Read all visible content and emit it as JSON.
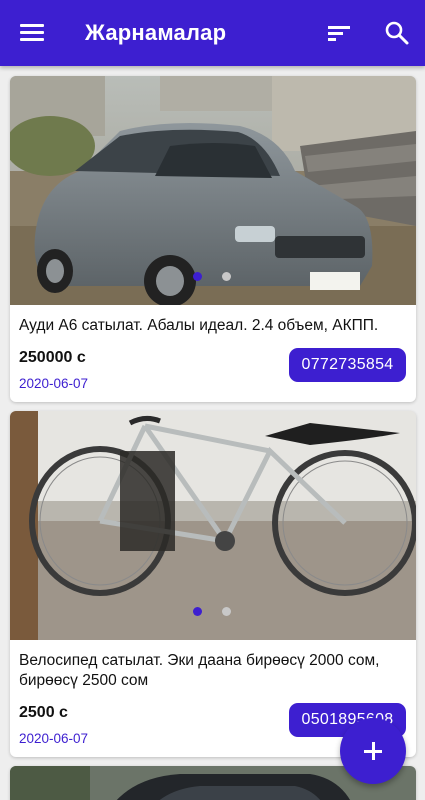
{
  "appbar": {
    "title": "Жарнамалар",
    "icons": [
      "menu-icon",
      "sort-icon",
      "search-icon"
    ]
  },
  "colors": {
    "primary": "#3d1fd0",
    "background": "#eeeeee",
    "card": "#ffffff"
  },
  "listings": [
    {
      "description": "Ауди А6 сатылат. Абалы идеал. 2.4 объем, АКПП.",
      "price": "250000 с",
      "date": "2020-06-07",
      "phone": "0772735854",
      "photo_count": 2,
      "active_photo": 0
    },
    {
      "description": "Велосипед сатылат. Эки даана бирөөсү 2000 сом, бирөөсү 2500 сом",
      "price": "2500 с",
      "date": "2020-06-07",
      "phone": "0501895608",
      "photo_count": 2,
      "active_photo": 0
    }
  ],
  "fab": {
    "icon": "plus-icon"
  }
}
